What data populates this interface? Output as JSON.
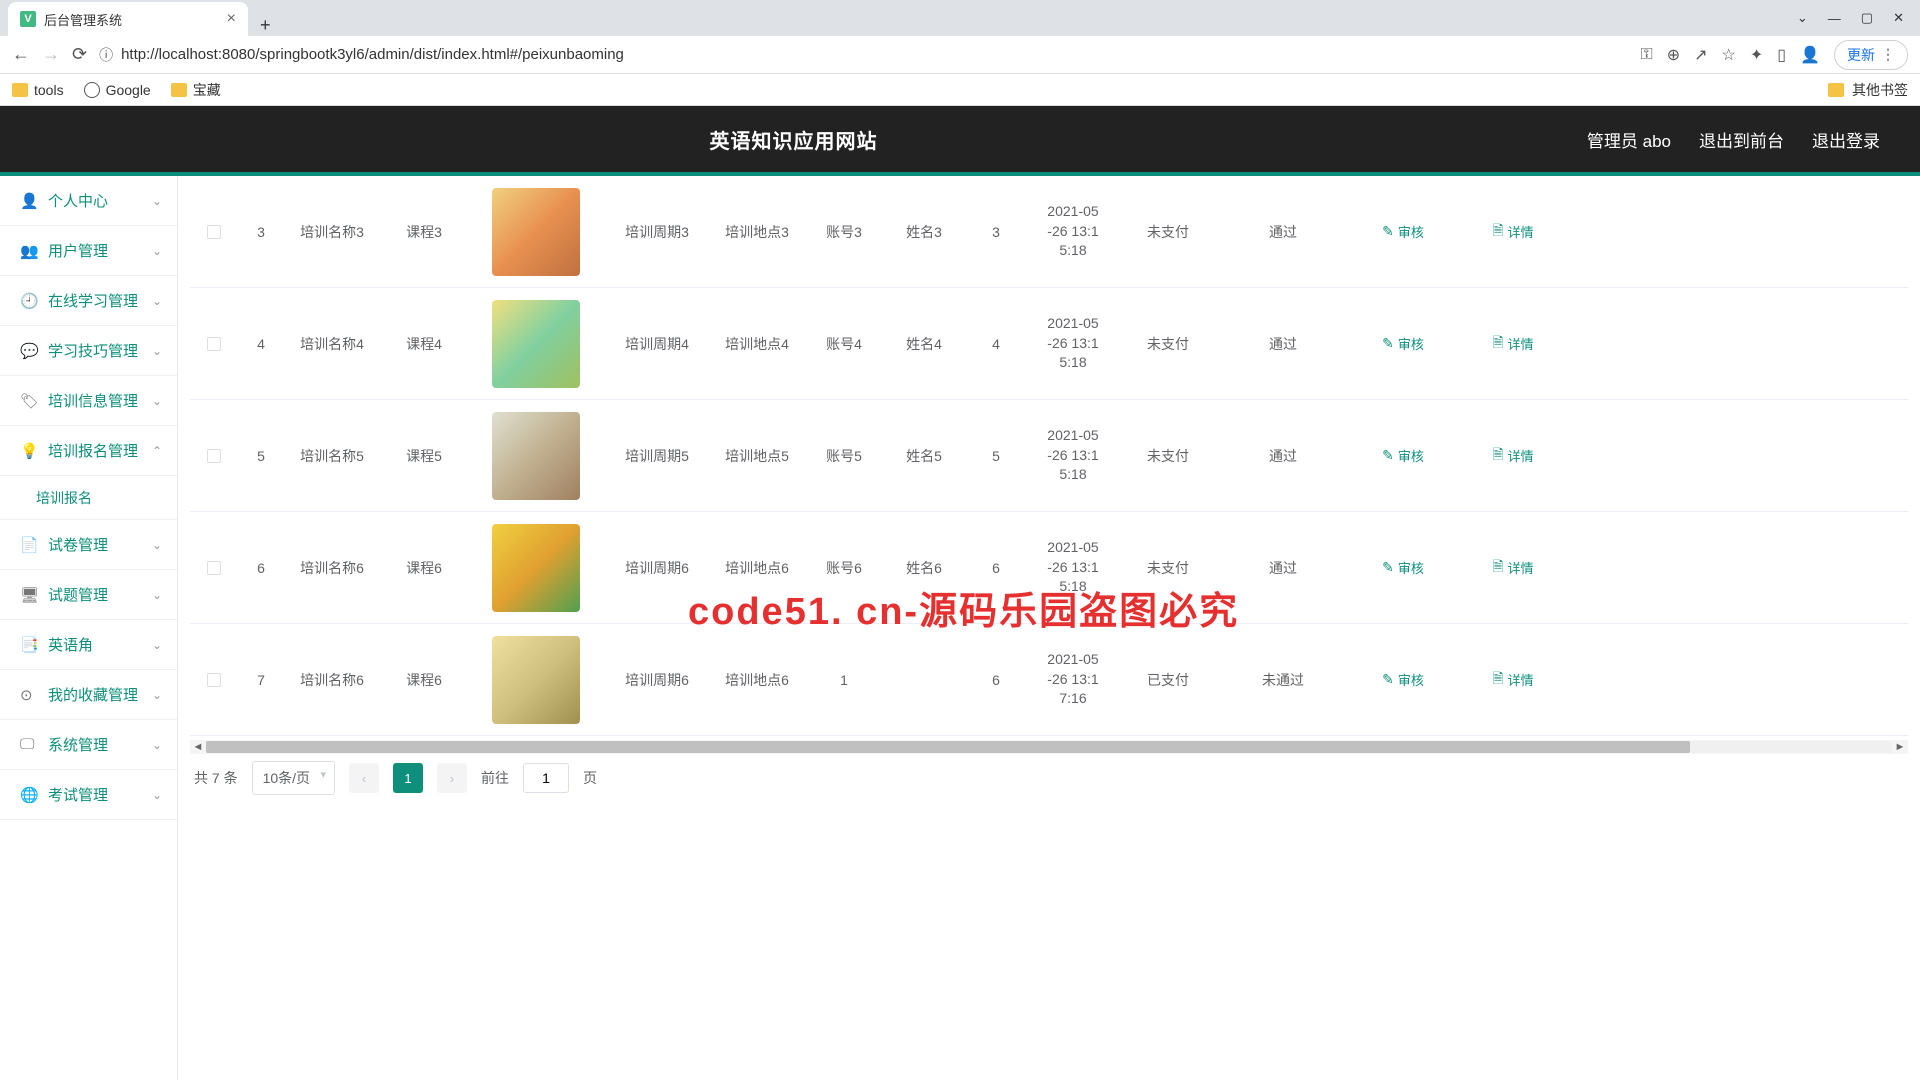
{
  "browser": {
    "tab_title": "后台管理系统",
    "url": "http://localhost:8080/springbootk3yl6/admin/dist/index.html#/peixunbaoming",
    "update_label": "更新",
    "bookmarks": [
      "tools",
      "Google",
      "宝藏"
    ],
    "other_bookmarks": "其他书签"
  },
  "header": {
    "title": "英语知识应用网站",
    "admin": "管理员 abo",
    "exit_front": "退出到前台",
    "logout": "退出登录"
  },
  "sidebar": [
    {
      "icon": "person",
      "label": "个人中心",
      "expand": "down"
    },
    {
      "icon": "people",
      "label": "用户管理",
      "expand": "down"
    },
    {
      "icon": "clock",
      "label": "在线学习管理",
      "expand": "down"
    },
    {
      "icon": "chat",
      "label": "学习技巧管理",
      "expand": "down"
    },
    {
      "icon": "info",
      "label": "培训信息管理",
      "expand": "down"
    },
    {
      "icon": "bulb",
      "label": "培训报名管理",
      "expand": "up"
    },
    {
      "icon": "doc",
      "label": "试卷管理",
      "expand": "down"
    },
    {
      "icon": "list",
      "label": "试题管理",
      "expand": "down"
    },
    {
      "icon": "tag",
      "label": "英语角",
      "expand": "down"
    },
    {
      "icon": "star",
      "label": "我的收藏管理",
      "expand": "down"
    },
    {
      "icon": "gear",
      "label": "系统管理",
      "expand": "down"
    },
    {
      "icon": "globe",
      "label": "考试管理",
      "expand": "down"
    }
  ],
  "sidebar_sub": "培训报名",
  "labels": {
    "name": "培训名称",
    "period": "培训周期",
    "place": "培训地点",
    "account": "账号",
    "uname": "姓名",
    "audit": "审核",
    "detail": "详情"
  },
  "rows": [
    {
      "id": "3",
      "name_suffix": "3",
      "course": "课程3",
      "thumb": "t1",
      "period": "3",
      "place": "3",
      "account": "账号3",
      "uname": "姓名3",
      "num": "3",
      "time": "2021-05-26 13:15:18",
      "pay": "未支付",
      "status": "通过"
    },
    {
      "id": "4",
      "name_suffix": "4",
      "course": "课程4",
      "thumb": "t2",
      "period": "4",
      "place": "4",
      "account": "账号4",
      "uname": "姓名4",
      "num": "4",
      "time": "2021-05-26 13:15:18",
      "pay": "未支付",
      "status": "通过"
    },
    {
      "id": "5",
      "name_suffix": "5",
      "course": "课程5",
      "thumb": "t3",
      "period": "5",
      "place": "5",
      "account": "账号5",
      "uname": "姓名5",
      "num": "5",
      "time": "2021-05-26 13:15:18",
      "pay": "未支付",
      "status": "通过"
    },
    {
      "id": "6",
      "name_suffix": "6",
      "course": "课程6",
      "thumb": "t4",
      "period": "6",
      "place": "6",
      "account": "账号6",
      "uname": "姓名6",
      "num": "6",
      "time": "2021-05-26 13:15:18",
      "pay": "未支付",
      "status": "通过"
    },
    {
      "id": "7",
      "name_suffix": "6",
      "course": "课程6",
      "thumb": "t5",
      "period": "6",
      "place": "6",
      "account": "1",
      "uname": "",
      "num": "6",
      "time": "2021-05-26 13:17:16",
      "pay": "已支付",
      "status": "未通过"
    }
  ],
  "pager": {
    "total_prefix": "共",
    "total_count": "7",
    "total_suffix": "条",
    "page_size": "10条/页",
    "current": "1",
    "goto": "前往",
    "page_input": "1",
    "page_suffix": "页"
  },
  "watermark_big": "code51. cn-源码乐园盗图必究",
  "watermark_small": "code51.cn"
}
